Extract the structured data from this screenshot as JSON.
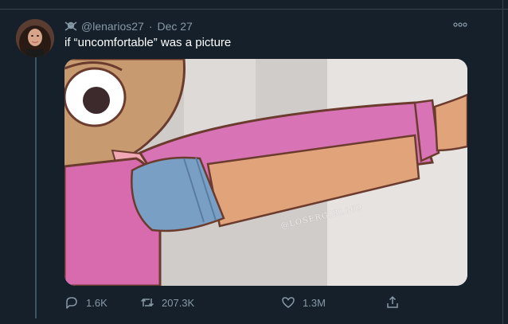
{
  "tweet": {
    "handle": "@lenarios27",
    "date": "Dec 27",
    "text": "if “uncomfortable” was a picture",
    "media": {
      "watermark": "@LOSERGIRL369"
    }
  },
  "actions": {
    "replies": "1.6K",
    "retweets": "207.3K",
    "likes": "1.3M"
  },
  "icons": {
    "badge": "skull-crossbones-icon",
    "more": "more-options-icon",
    "reply": "reply-icon",
    "retweet": "retweet-icon",
    "like": "heart-icon",
    "share": "share-icon"
  },
  "colors": {
    "background": "#15202b",
    "secondary_text": "#8899a6",
    "primary_text": "#ffffff"
  }
}
